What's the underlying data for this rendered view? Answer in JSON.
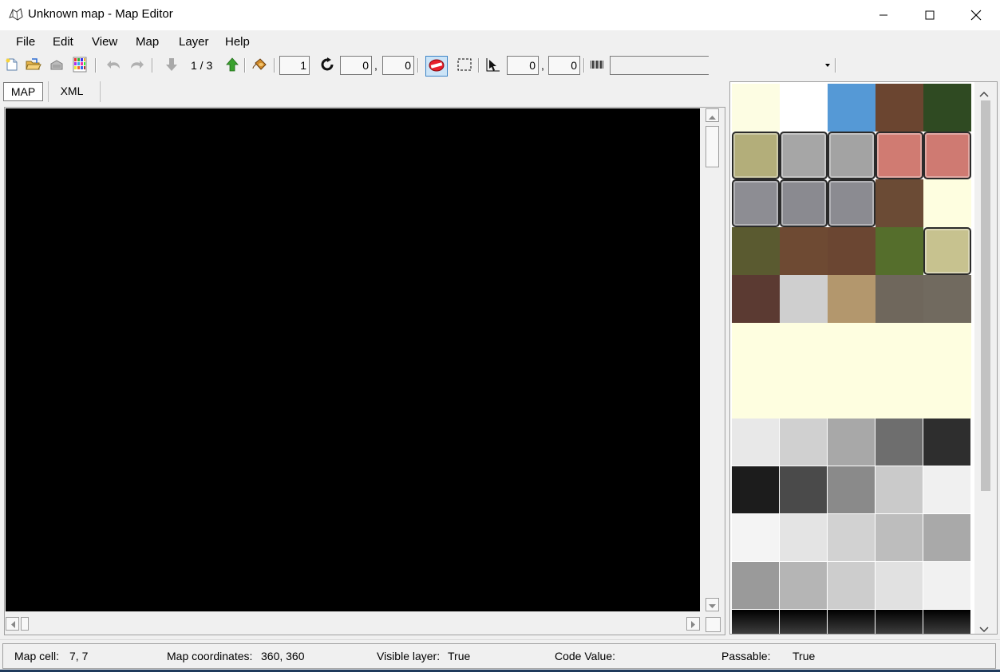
{
  "window": {
    "title": "Unknown map - Map Editor",
    "controls": {
      "minimize": "minimize-icon",
      "maximize": "maximize-icon",
      "close": "close-icon"
    }
  },
  "menu": {
    "file": "File",
    "edit": "Edit",
    "view": "View",
    "map": "Map",
    "layer": "Layer",
    "help": "Help"
  },
  "toolbar": {
    "layer_indicator": "1 / 3",
    "brush_size": "1",
    "offset_x": "0",
    "offset_y": "0",
    "offset_sep": ",",
    "select_x": "0",
    "select_y": "0",
    "select_sep": ",",
    "code_value": "",
    "combo_value": ""
  },
  "tabs": {
    "map": "MAP",
    "xml": "XML"
  },
  "tiles": {
    "rows": [
      [
        "#fdfde3",
        "#ffffff",
        "#5599d6",
        "#6b4530",
        "#2f4a22"
      ],
      [
        "#b3ae7a",
        "#a6a6a6",
        "#a3a3a3",
        "#d07b72",
        "#cf7a72"
      ],
      [
        "#8d8d93",
        "#8a8a90",
        "#8b8b91",
        "#6b4b35",
        "#fefee0"
      ],
      [
        "#5a5a30",
        "#6e4a33",
        "#6b4632",
        "#556e2c",
        "#c7c28f"
      ],
      [
        "#5b3a32",
        "#cfcfcf",
        "#b3976d",
        "#6f675c",
        "#716a5f"
      ],
      [
        "#fefee0",
        "#fefee0",
        "#fefee0",
        "#fefee0",
        "#fefee0"
      ],
      [
        "#fefee0",
        "#fefee0",
        "#fefee0",
        "#fefee0",
        "#fefee0"
      ],
      [
        "#e8e8e8",
        "#d0d0d0",
        "#a8a8a8",
        "#6e6e6e",
        "#2e2e2e"
      ],
      [
        "#1c1c1c",
        "#4a4a4a",
        "#8a8a8a",
        "#cacaca",
        "#f0f0f0"
      ],
      [
        "#f4f4f4",
        "#e4e4e4",
        "#d2d2d2",
        "#bdbdbd",
        "#a9a9a9"
      ],
      [
        "#9a9a9a",
        "#b5b5b5",
        "#cdcdcd",
        "#e1e1e1",
        "#f1f1f1"
      ],
      [
        "#7a7a7a",
        "#7a7a7a",
        "#7a7a7a",
        "#7a7a7a",
        "#7a7a7a"
      ]
    ]
  },
  "status": {
    "map_cell_label": "Map cell:",
    "map_cell_value": "7, 7",
    "map_coords_label": "Map coordinates:",
    "map_coords_value": "360, 360",
    "visible_layer_label": "Visible layer:",
    "visible_layer_value": "True",
    "code_value_label": "Code Value:",
    "code_value_value": "",
    "passable_label": "Passable:",
    "passable_value": "True"
  }
}
